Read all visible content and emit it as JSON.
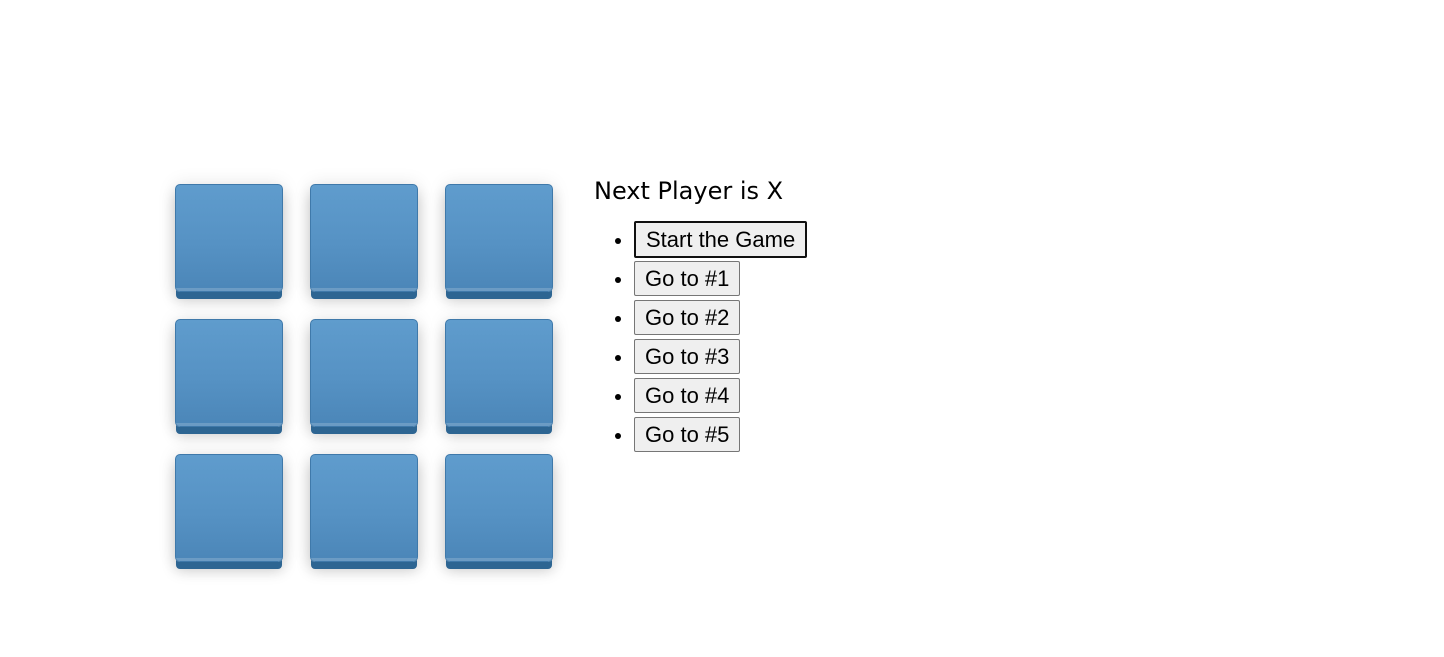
{
  "board": {
    "squares": [
      "",
      "",
      "",
      "",
      "",
      "",
      "",
      "",
      ""
    ],
    "square_color": "#5692c4"
  },
  "status": "Next Player is X",
  "moves": [
    "Start the Game",
    "Go to #1",
    "Go to #2",
    "Go to #3",
    "Go to #4",
    "Go to #5"
  ]
}
